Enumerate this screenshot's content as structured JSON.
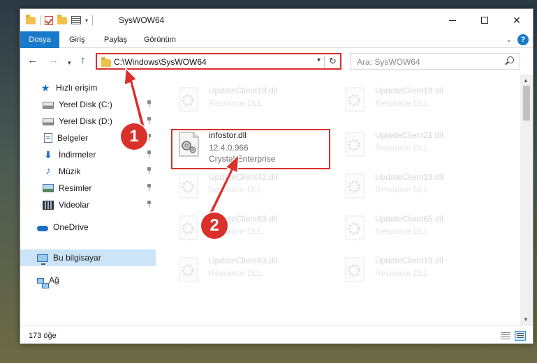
{
  "window": {
    "title": "SysWOW64"
  },
  "ribbon": {
    "tabs": [
      "Dosya",
      "Giriş",
      "Paylaş",
      "Görünüm"
    ],
    "help_label": "?"
  },
  "address": {
    "path": "C:\\Windows\\SysWOW64"
  },
  "search": {
    "placeholder": "Ara: SysWOW64"
  },
  "sidebar": {
    "items": [
      {
        "label": "Hızlı erişim",
        "icon": "star-icon"
      },
      {
        "label": "Yerel Disk (C:)",
        "icon": "drive-icon",
        "pinned": true
      },
      {
        "label": "Yerel Disk (D:)",
        "icon": "drive-icon",
        "pinned": true
      },
      {
        "label": "Belgeler",
        "icon": "documents-icon",
        "pinned": true
      },
      {
        "label": "İndirmeler",
        "icon": "download-icon",
        "pinned": true
      },
      {
        "label": "Müzik",
        "icon": "music-icon",
        "pinned": true
      },
      {
        "label": "Resimler",
        "icon": "pictures-icon",
        "pinned": true
      },
      {
        "label": "Videolar",
        "icon": "video-icon",
        "pinned": true
      },
      {
        "label": "OneDrive",
        "icon": "cloud-icon"
      },
      {
        "label": "Bu bilgisayar",
        "icon": "computer-icon",
        "selected": true
      },
      {
        "label": "Ağ",
        "icon": "network-icon"
      }
    ]
  },
  "files": [
    {
      "name": "UpdateClient19.dll",
      "type": "Resource DLL"
    },
    {
      "name": "UpdateClient19.dll",
      "type": "Resource DLL"
    },
    {
      "name": "infostor.dll",
      "version": "12.4.0.966",
      "company": "Crystal Enterprise"
    },
    {
      "name": "UpdateClient21.dll",
      "type": "Resource DLL"
    },
    {
      "name": "UpdateClient42.dll",
      "type": "Resource DLL"
    },
    {
      "name": "UpdateClient19.dll",
      "type": "Resource DLL"
    },
    {
      "name": "UpdateClient63.dll",
      "type": "Resource DLL"
    },
    {
      "name": "UpdateClient65.dll",
      "type": "Resource DLL"
    },
    {
      "name": "UpdateClient63.dll",
      "type": "Resource DLL"
    },
    {
      "name": "UpdateClient19.dll",
      "type": "Resource DLL"
    }
  ],
  "status": {
    "item_count": "173 öğe"
  },
  "annotations": {
    "step1": "1",
    "step2": "2",
    "color": "#d9302c"
  }
}
